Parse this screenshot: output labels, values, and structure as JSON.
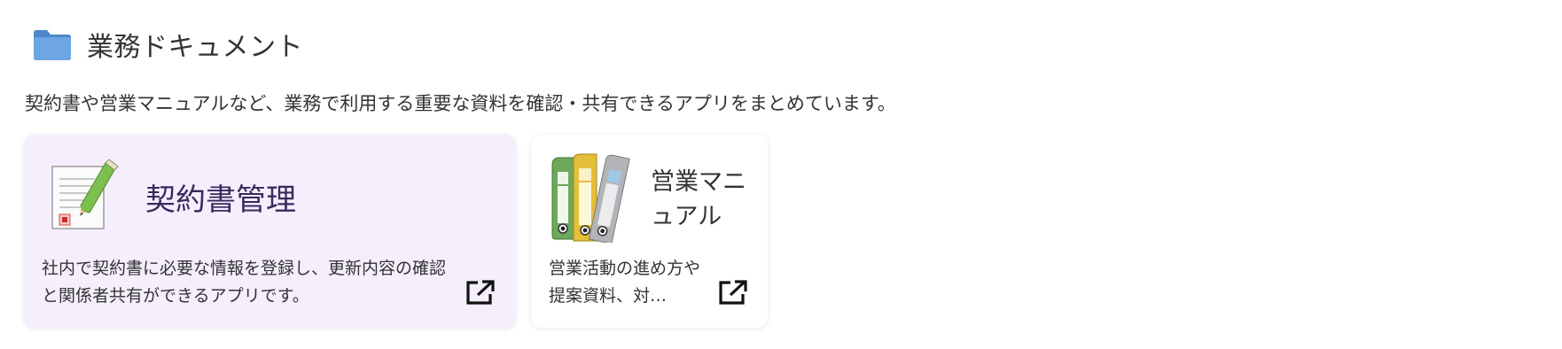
{
  "section": {
    "icon": "folder-icon",
    "title": "業務ドキュメント",
    "description": "契約書や営業マニュアルなど、業務で利用する重要な資料を確認・共有できるアプリをまとめています。"
  },
  "cards": [
    {
      "icon": "contract-document-icon",
      "title": "契約書管理",
      "description": "社内で契約書に必要な情報を登録し、更新内容の確認と関係者共有ができるアプリです。",
      "action_icon": "open-external-icon",
      "highlighted": true
    },
    {
      "icon": "binders-icon",
      "title": "営業マニュアル",
      "description": "営業活動の進め方や提案資料、対…",
      "action_icon": "open-external-icon",
      "highlighted": false
    }
  ],
  "colors": {
    "folder": "#5b93d6",
    "highlight_bg": "#f4eefd",
    "title_purple": "#3a2a5e"
  }
}
